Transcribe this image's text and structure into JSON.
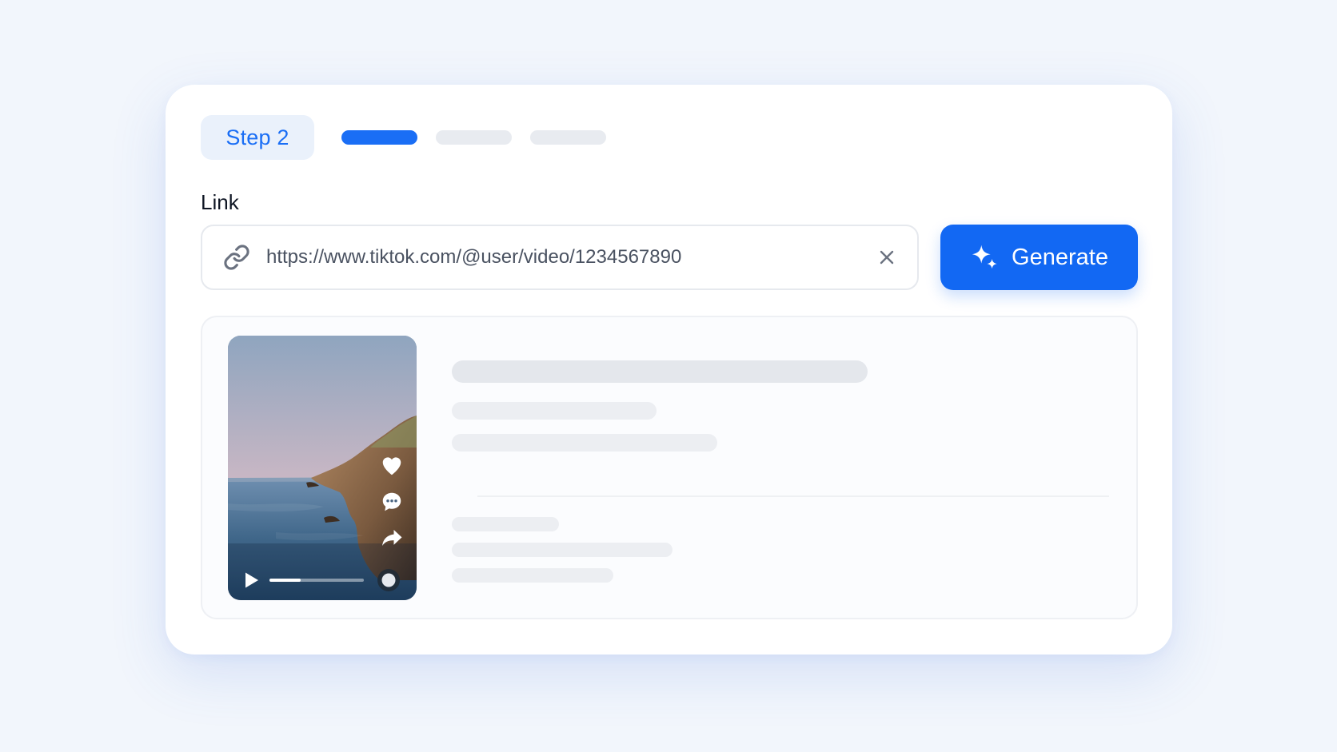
{
  "stepper": {
    "label": "Step 2",
    "total_steps": 3,
    "current_step": 1
  },
  "link_field": {
    "label": "Link",
    "value": "https://www.tiktok.com/@user/video/1234567890"
  },
  "generate_button": {
    "label": "Generate",
    "icon": "sparkle-icon"
  },
  "preview": {
    "video": {
      "progress": 0.33,
      "actions": [
        "heart-icon",
        "comment-icon",
        "share-icon"
      ],
      "controls": [
        "play-icon",
        "record-icon"
      ]
    },
    "loading": true
  },
  "colors": {
    "accent": "#1268f3",
    "accent_text": "#1a6ef5",
    "badge_bg": "#eaf1fb",
    "skeleton": "#e4e7ec",
    "background": "#f2f6fc"
  }
}
